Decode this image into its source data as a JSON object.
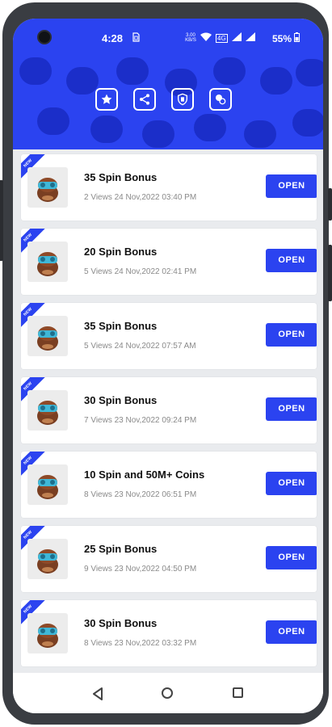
{
  "status_bar": {
    "time": "4:28",
    "sim_icon": "sim-card-icon",
    "data_speed": "3.00 KB/S",
    "network_label": "4G",
    "battery": "55%"
  },
  "toolbar": {
    "icons": [
      "star-icon",
      "share-icon",
      "privacy-icon",
      "chat-icon"
    ]
  },
  "list": {
    "ribbon_label": "NEW",
    "open_label": "OPEN",
    "items": [
      {
        "title": "35 Spin Bonus",
        "meta": "2 Views 24 Nov,2022 03:40 PM"
      },
      {
        "title": "20 Spin Bonus",
        "meta": "5 Views 24 Nov,2022 02:41 PM"
      },
      {
        "title": "35 Spin Bonus",
        "meta": "5 Views 24 Nov,2022 07:57 AM"
      },
      {
        "title": "30 Spin Bonus",
        "meta": "7 Views 23 Nov,2022 09:24 PM"
      },
      {
        "title": "10 Spin and 50M+ Coins",
        "meta": "8 Views 23 Nov,2022 06:51 PM"
      },
      {
        "title": "25 Spin Bonus",
        "meta": "9 Views 23 Nov,2022 04:50 PM"
      },
      {
        "title": "30 Spin Bonus",
        "meta": "8 Views 23 Nov,2022 03:32 PM"
      }
    ]
  },
  "colors": {
    "accent": "#2b43f0",
    "background": "#e9ebee",
    "card": "#ffffff",
    "device_frame": "#3a3d42"
  }
}
